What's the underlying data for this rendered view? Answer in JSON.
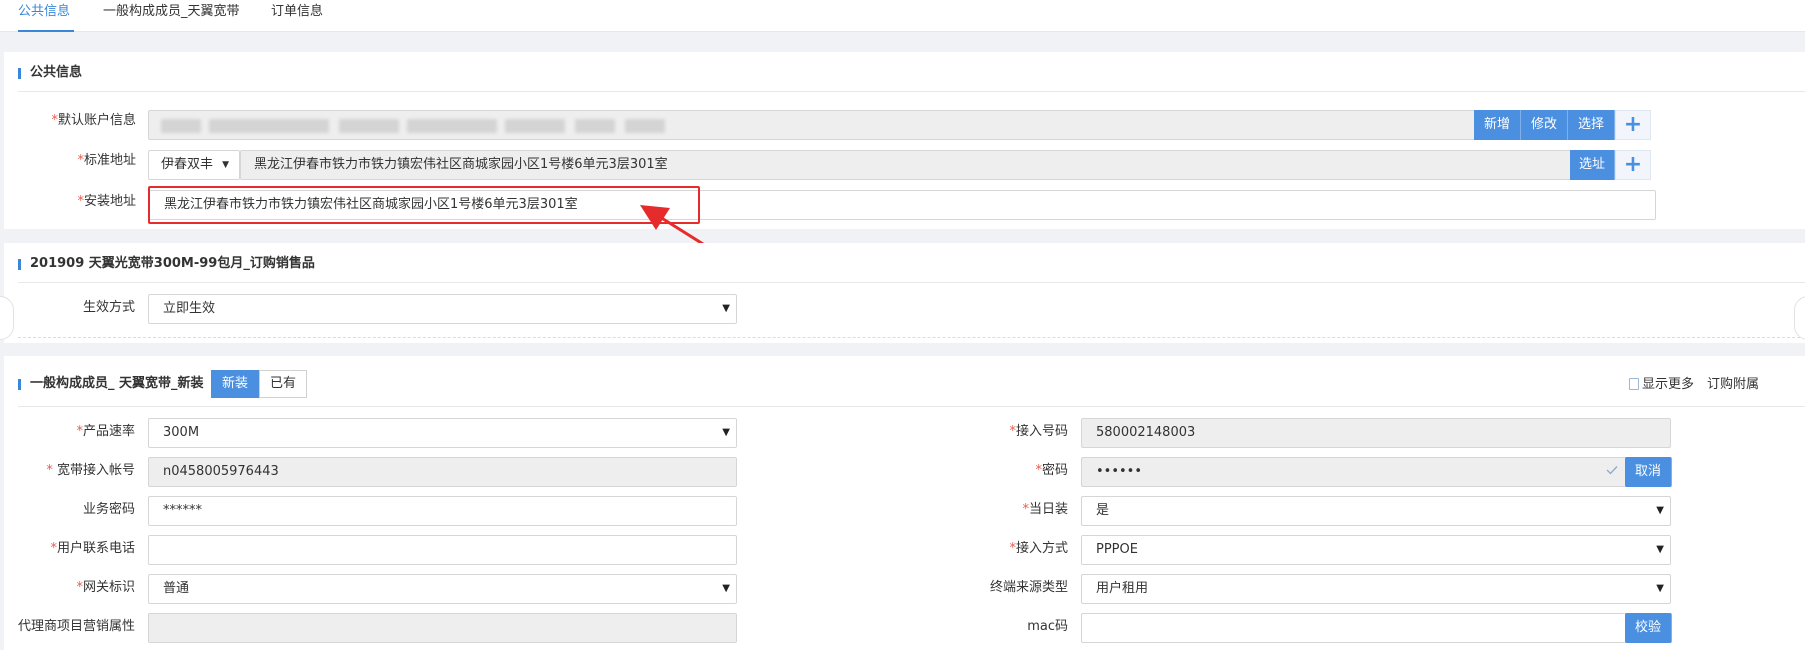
{
  "tabs": [
    {
      "label": "公共信息",
      "active": true
    },
    {
      "label": "一般构成成员_天翼宽带",
      "active": false
    },
    {
      "label": "订单信息",
      "active": false
    }
  ],
  "public_info": {
    "title": "公共信息",
    "account": {
      "label": "默认账户信息",
      "buttons": [
        "新增",
        "修改",
        "选择"
      ],
      "plus": "+"
    },
    "std_address": {
      "label": "标准地址",
      "region": "伊春双丰",
      "value": "黑龙江伊春市铁力市铁力镇宏伟社区商城家园小区1号楼6单元3层301室",
      "button": "选址",
      "plus": "+"
    },
    "install_address": {
      "label": "安装地址",
      "value": "黑龙江伊春市铁力市铁力镇宏伟社区商城家园小区1号楼6单元3层301室"
    }
  },
  "product_section": {
    "title": "201909 天翼光宽带300M-99包月_订购销售品",
    "effect": {
      "label": "生效方式",
      "value": "立即生效"
    }
  },
  "member_section": {
    "title": "一般构成成员_ 天翼宽带_新装",
    "toggle": [
      "新装",
      "已有"
    ],
    "links": {
      "show_more": "显示更多",
      "order_attach": "订购附属"
    },
    "left_fields": [
      {
        "label": "产品速率",
        "required": true,
        "value": "300M",
        "type": "select"
      },
      {
        "label": " 宽带接入帐号",
        "required": true,
        "value": "n0458005976443",
        "type": "readonly"
      },
      {
        "label": "业务密码",
        "required": false,
        "value": "******",
        "type": "input"
      },
      {
        "label": "用户联系电话",
        "required": true,
        "value": "",
        "type": "input"
      },
      {
        "label": "网关标识",
        "required": true,
        "value": "普通",
        "type": "select"
      },
      {
        "label": "代理商项目营销属性",
        "required": false,
        "value": "",
        "type": "readonly"
      }
    ],
    "right_fields": [
      {
        "label": "接入号码",
        "required": true,
        "value": "580002148003",
        "type": "readonly"
      },
      {
        "label": "密码",
        "required": true,
        "value": "••••••",
        "type": "password",
        "button": "取消"
      },
      {
        "label": "当日装",
        "required": true,
        "value": "是",
        "type": "select"
      },
      {
        "label": "接入方式",
        "required": true,
        "value": "PPPOE",
        "type": "select"
      },
      {
        "label": "终端来源类型",
        "required": false,
        "value": "用户租用",
        "type": "select"
      },
      {
        "label": "mac码",
        "required": false,
        "value": "",
        "type": "input",
        "button": "校验"
      }
    ]
  },
  "required_mark": "*",
  "select_caret": "▼",
  "colors": {
    "accent": "#4a8fe0",
    "required": "#e95b4f",
    "annotation": "#e52b2b"
  }
}
